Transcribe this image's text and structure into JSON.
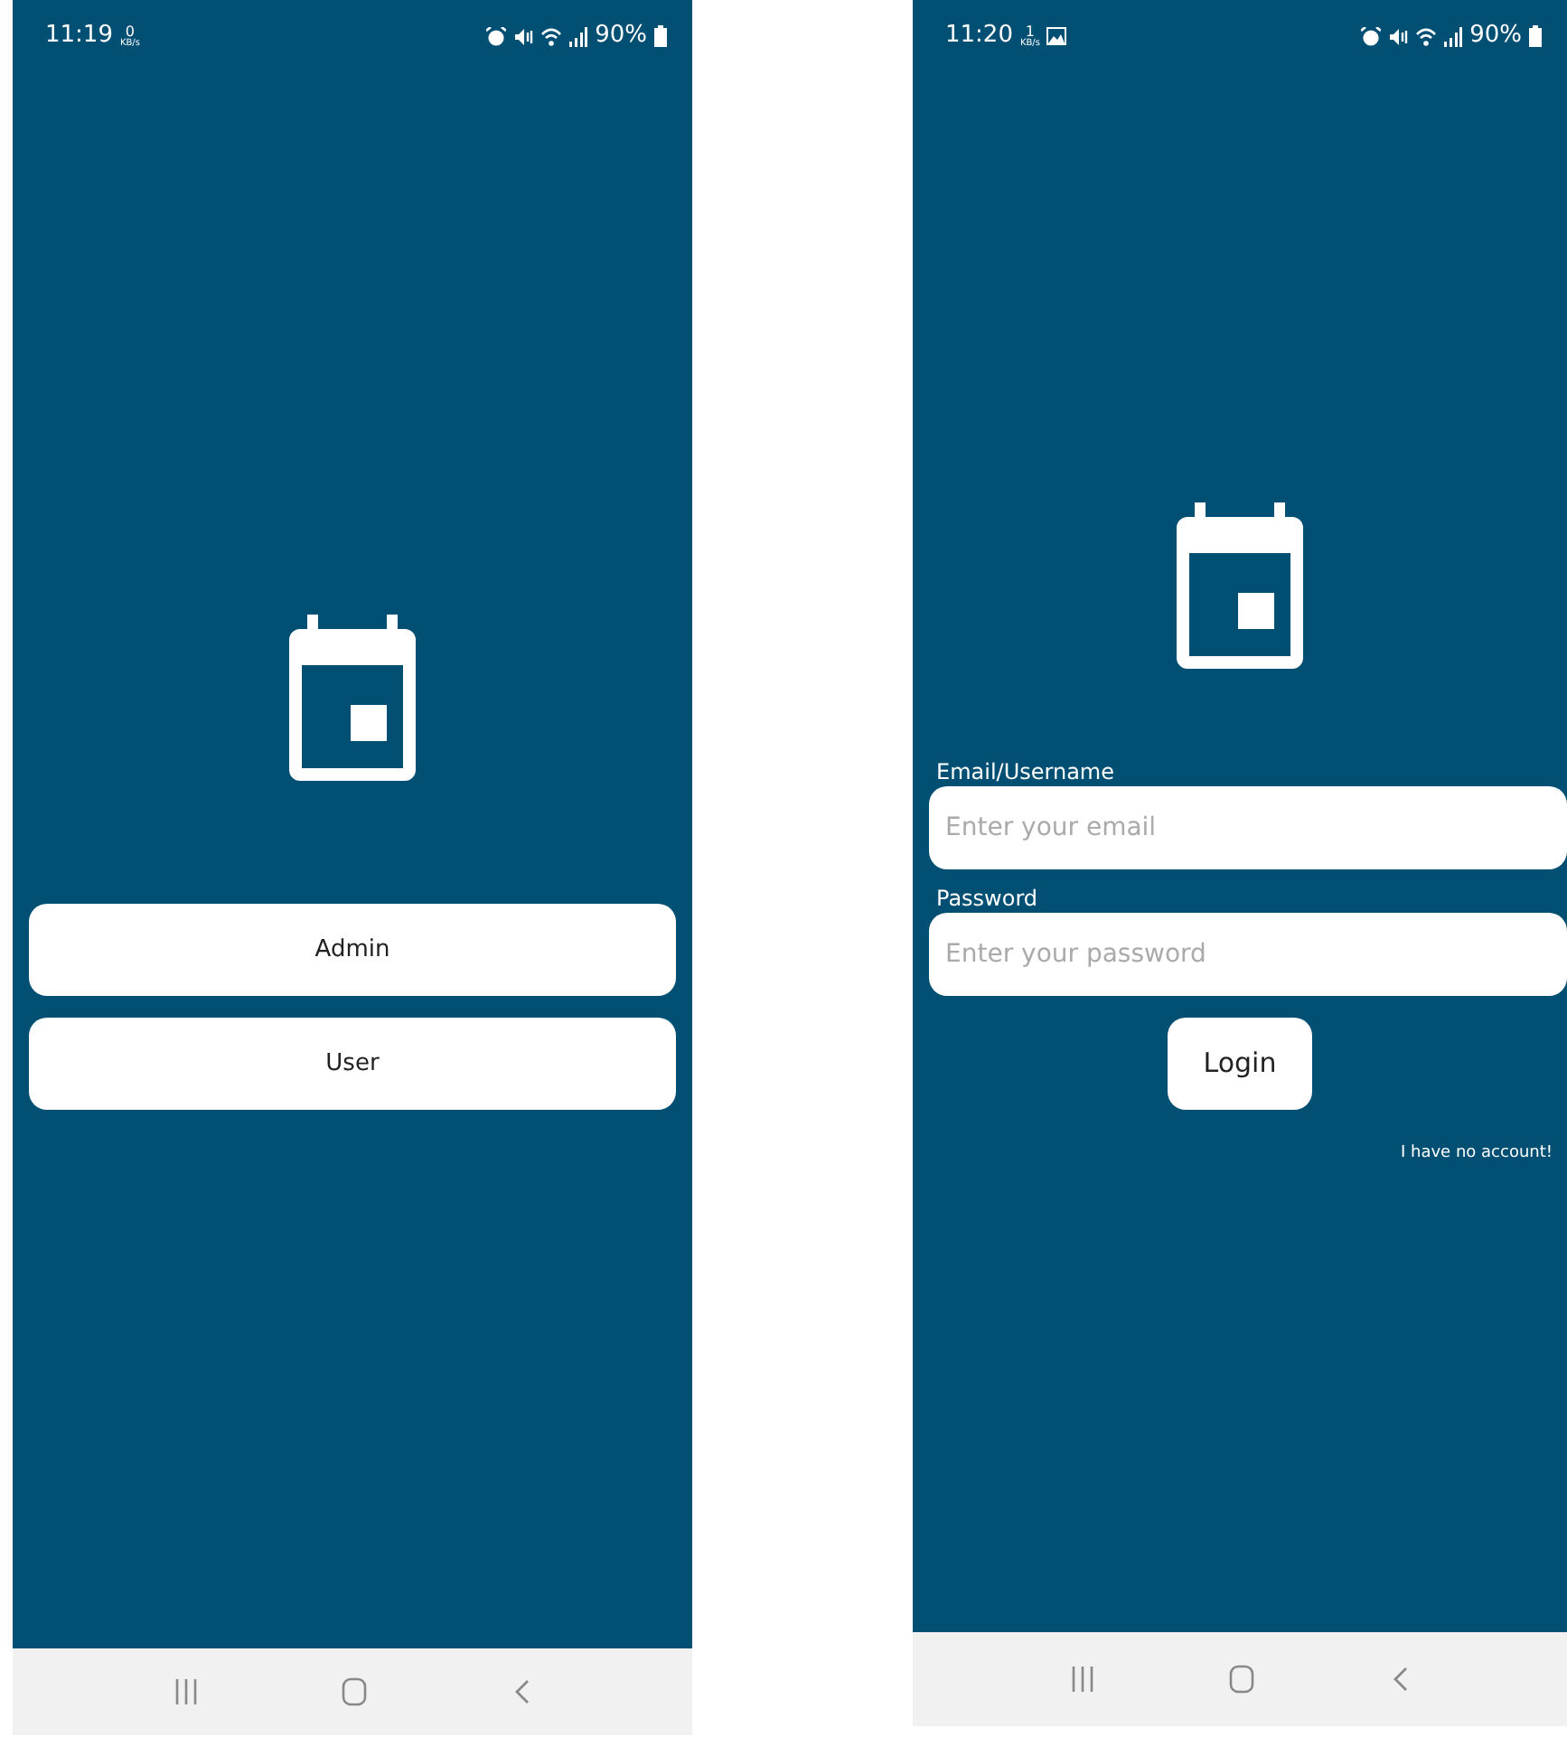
{
  "screens": [
    {
      "kind": "role_select",
      "status_bar": {
        "time": "11:19",
        "net_speed": "0",
        "net_unit": "KB/s",
        "screenshot_note": false,
        "battery": "90%"
      },
      "buttons": [
        {
          "label": "Admin"
        },
        {
          "label": "User"
        }
      ]
    },
    {
      "kind": "login",
      "status_bar": {
        "time": "11:20",
        "net_speed": "1",
        "net_unit": "KB/s",
        "screenshot_note": true,
        "battery": "90%"
      },
      "fields": [
        {
          "label": "Email/Username",
          "placeholder": "Enter your email"
        },
        {
          "label": "Password",
          "placeholder": "Enter your password"
        }
      ],
      "submit": "Login",
      "link": "I have no account!"
    }
  ]
}
